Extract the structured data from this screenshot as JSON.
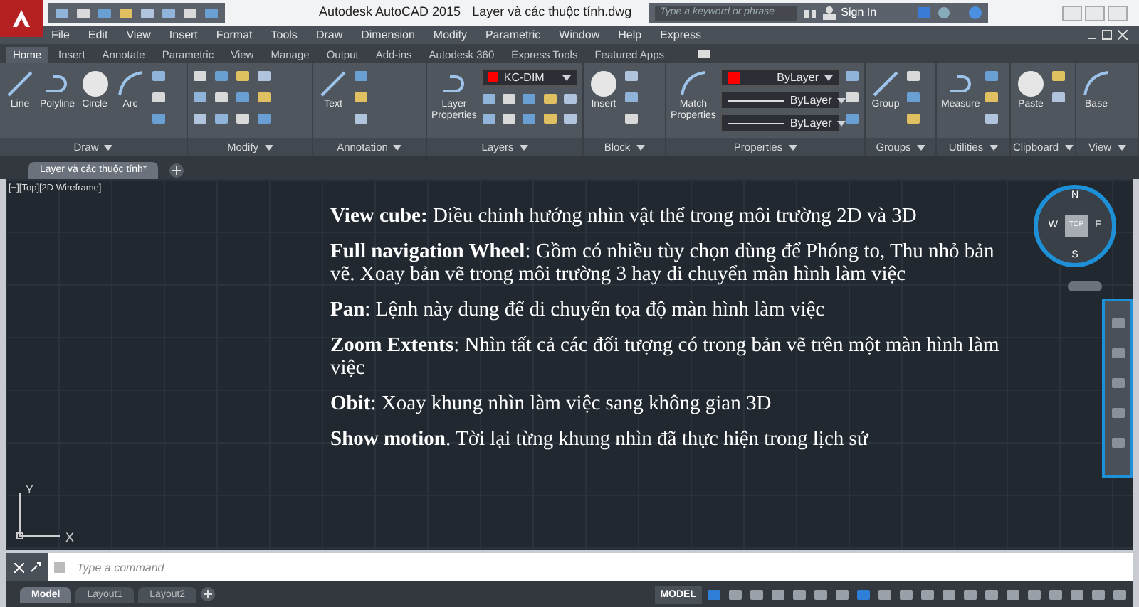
{
  "title_bar": {
    "app": "Autodesk AutoCAD 2015",
    "document": "Layer và các thuộc tính.dwg",
    "search": {
      "placeholder": "Type a keyword or phrase"
    },
    "sign_in": "Sign In"
  },
  "menu_bar": [
    "File",
    "Edit",
    "View",
    "Insert",
    "Format",
    "Tools",
    "Draw",
    "Dimension",
    "Modify",
    "Parametric",
    "Window",
    "Help",
    "Express"
  ],
  "ribbon_tabs": [
    {
      "label": "Home",
      "selected": true
    },
    {
      "label": "Insert",
      "selected": false
    },
    {
      "label": "Annotate",
      "selected": false
    },
    {
      "label": "Parametric",
      "selected": false
    },
    {
      "label": "View",
      "selected": false
    },
    {
      "label": "Manage",
      "selected": false
    },
    {
      "label": "Output",
      "selected": false
    },
    {
      "label": "Add-ins",
      "selected": false
    },
    {
      "label": "Autodesk 360",
      "selected": false
    },
    {
      "label": "Express Tools",
      "selected": false
    },
    {
      "label": "Featured Apps",
      "selected": false
    }
  ],
  "ribbon_panels": [
    {
      "title": "Draw",
      "tools": [
        "Line",
        "Polyline",
        "Circle",
        "Arc"
      ]
    },
    {
      "title": "Modify"
    },
    {
      "title": "Annotation",
      "tools": [
        "Text"
      ]
    },
    {
      "title": "Layers",
      "tools": [
        "Layer Properties"
      ],
      "dropdowns": [
        {
          "kind": "layer",
          "label": "KC-DIM",
          "color": "#ff0000"
        }
      ]
    },
    {
      "title": "Block",
      "tools": [
        "Insert"
      ]
    },
    {
      "title": "Properties",
      "tools": [
        "Match Properties"
      ],
      "dropdowns": [
        {
          "kind": "color",
          "label": "ByLayer",
          "color": "#ff0000"
        },
        {
          "kind": "line",
          "label": "ByLayer"
        },
        {
          "kind": "line",
          "label": "ByLayer"
        }
      ]
    },
    {
      "title": "Groups",
      "tools": [
        "Group"
      ]
    },
    {
      "title": "Utilities",
      "tools": [
        "Measure"
      ]
    },
    {
      "title": "Clipboard",
      "tools": [
        "Paste"
      ]
    },
    {
      "title": "View",
      "tools": [
        "Base"
      ]
    }
  ],
  "document_tabs": [
    {
      "label": "Layer và các thuộc tính*",
      "selected": true
    }
  ],
  "viewport": {
    "label": "[−][Top][2D Wireframe]",
    "notes": [
      "**View cube:** Điều chinh hướng nhìn vật thể trong môi trường 2D và 3D",
      "**Full navigation Wheel**:  Gồm có nhiều tùy chọn dùng để Phóng to, Thu nhỏ bản vẽ. Xoay bản vẽ trong môi trường 3 hay di chuyển màn hình làm việc",
      "**Pan**: Lệnh này dung để di chuyển tọa độ màn hình làm việc",
      "**Zoom Extents**: Nhìn tất cả các đối tượng có trong bản vẽ trên một màn hình làm việc",
      "**Obit**: Xoay khung nhìn làm việc sang không gian 3D",
      "**Show motion**. Tời lại từng khung nhìn đã thực hiện trong lịch sử"
    ],
    "compass": {
      "north": "N",
      "south": "S",
      "west": "W",
      "east": "E",
      "face": "TOP"
    },
    "ucs": {
      "y": "Y",
      "x": "X"
    }
  },
  "command_line": {
    "placeholder": "Type a command"
  },
  "layout_tabs": [
    {
      "label": "Model",
      "selected": true
    },
    {
      "label": "Layout1",
      "selected": false
    },
    {
      "label": "Layout2",
      "selected": false
    }
  ],
  "status_bar": {
    "mode": "MODEL"
  }
}
